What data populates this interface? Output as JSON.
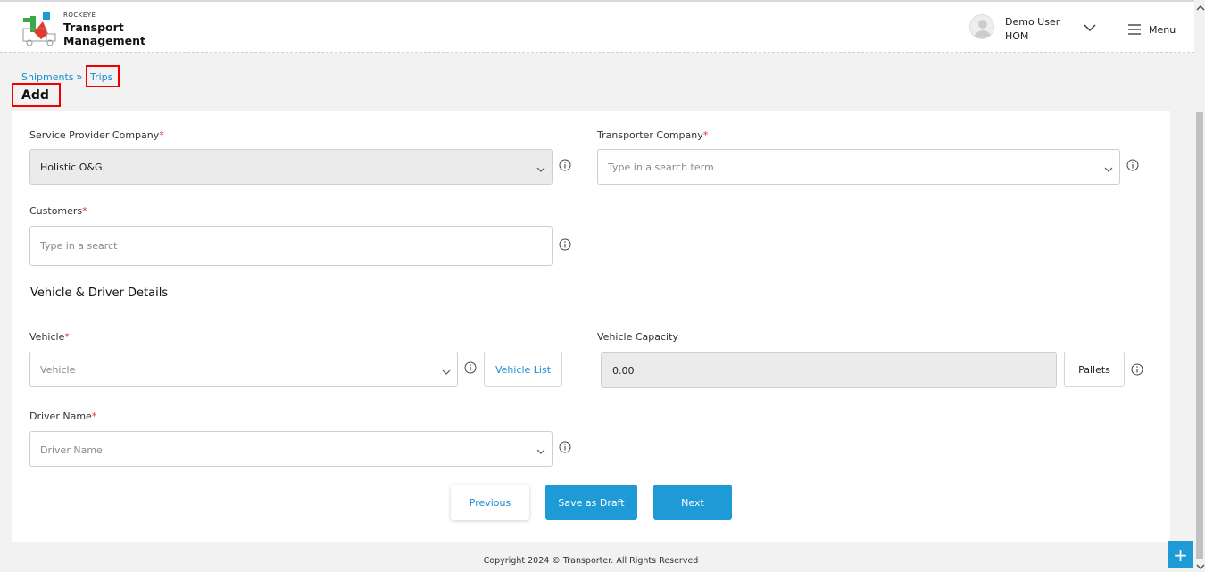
{
  "header": {
    "brand_small": "ROCKEYE",
    "brand_line1": "Transport",
    "brand_line2": "Management",
    "user_name": "Demo User",
    "user_org": "HOM",
    "menu_label": "Menu"
  },
  "breadcrumb": {
    "item1": "Shipments",
    "separator": "»",
    "item2": "Trips"
  },
  "page_title": "Add",
  "form": {
    "service_provider": {
      "label": "Service Provider Company",
      "required": "*",
      "value": "Holistic O&G."
    },
    "transporter": {
      "label": "Transporter Company",
      "required": "*",
      "placeholder": "Type in a search term"
    },
    "customers": {
      "label": "Customers",
      "required": "*",
      "placeholder": "Type in a searct"
    },
    "section_title": "Vehicle & Driver Details",
    "vehicle": {
      "label": "Vehicle",
      "required": "*",
      "placeholder": "Vehicle",
      "list_button": "Vehicle List"
    },
    "capacity": {
      "label": "Vehicle Capacity",
      "value": "0.00",
      "unit_button": "Pallets"
    },
    "driver": {
      "label": "Driver Name",
      "required": "*",
      "placeholder": "Driver Name"
    }
  },
  "actions": {
    "previous": "Previous",
    "save_draft": "Save as Draft",
    "next": "Next"
  },
  "footer": "Copyright 2024 © Transporter. All Rights Reserved",
  "fab_label": "+",
  "colors": {
    "accent": "#1e9ad6",
    "highlight": "#ee0000"
  }
}
